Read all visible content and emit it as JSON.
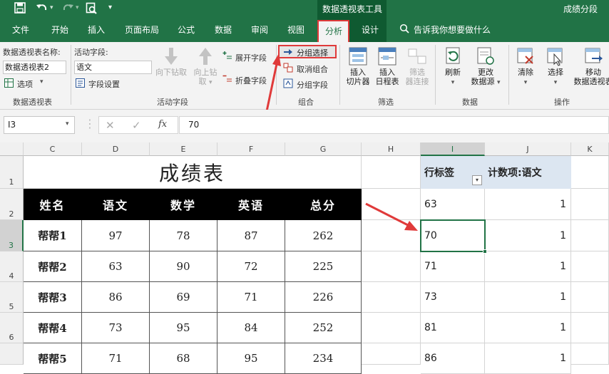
{
  "title_bar": {
    "context_title": "数据透视表工具",
    "file_name": "成绩分段"
  },
  "tabs": [
    "文件",
    "开始",
    "插入",
    "页面布局",
    "公式",
    "数据",
    "审阅",
    "视图",
    "分析",
    "设计"
  ],
  "tell_me": "告诉我你想要做什么",
  "ribbon": {
    "pivot_name_label": "数据透视表名称:",
    "pivot_name_value": "数据透视表2",
    "options_label": "选项",
    "group_pivot": "数据透视表",
    "active_field_label": "活动字段:",
    "active_field_value": "语文",
    "field_settings": "字段设置",
    "drill_down": "向下钻取",
    "drill_up_1": "向上钻",
    "drill_up_2": "取",
    "expand_field": "展开字段",
    "collapse_field": "折叠字段",
    "group_active_field": "活动字段",
    "group_selection": "分组选择",
    "ungroup": "取消组合",
    "group_field": "分组字段",
    "group_group": "组合",
    "insert_slicer_1": "插入",
    "insert_slicer_2": "切片器",
    "insert_timeline_1": "插入",
    "insert_timeline_2": "日程表",
    "filter_conn_1": "筛选",
    "filter_conn_2": "器连接",
    "group_filter": "筛选",
    "refresh": "刷新",
    "change_source_1": "更改",
    "change_source_2": "数据源",
    "group_data": "数据",
    "clear": "清除",
    "select": "选择",
    "move_1": "移动",
    "move_2": "数据透视表",
    "group_actions": "操作"
  },
  "formula_bar": {
    "name_box": "I3",
    "fx": "fx",
    "value": "70"
  },
  "columns": [
    "C",
    "D",
    "E",
    "F",
    "G",
    "H",
    "I",
    "J",
    "K"
  ],
  "rows": [
    "1",
    "2",
    "3",
    "4",
    "5",
    "6"
  ],
  "sheet": {
    "title": "成绩表",
    "headers": [
      "姓名",
      "语文",
      "数学",
      "英语",
      "总分"
    ],
    "data": [
      [
        "帮帮1",
        "97",
        "78",
        "87",
        "262"
      ],
      [
        "帮帮2",
        "63",
        "90",
        "72",
        "225"
      ],
      [
        "帮帮3",
        "86",
        "69",
        "71",
        "226"
      ],
      [
        "帮帮4",
        "73",
        "95",
        "84",
        "252"
      ],
      [
        "帮帮5",
        "71",
        "68",
        "95",
        "234"
      ]
    ]
  },
  "pivot": {
    "row_label": "行标签",
    "count_label": "计数项:语文",
    "rows": [
      [
        "63",
        "1"
      ],
      [
        "70",
        "1"
      ],
      [
        "71",
        "1"
      ],
      [
        "73",
        "1"
      ],
      [
        "81",
        "1"
      ],
      [
        "86",
        "1"
      ]
    ]
  },
  "colors": {
    "excel_green": "#217346",
    "highlight_red": "#e03a3a",
    "pivot_header": "#dce6f1"
  }
}
